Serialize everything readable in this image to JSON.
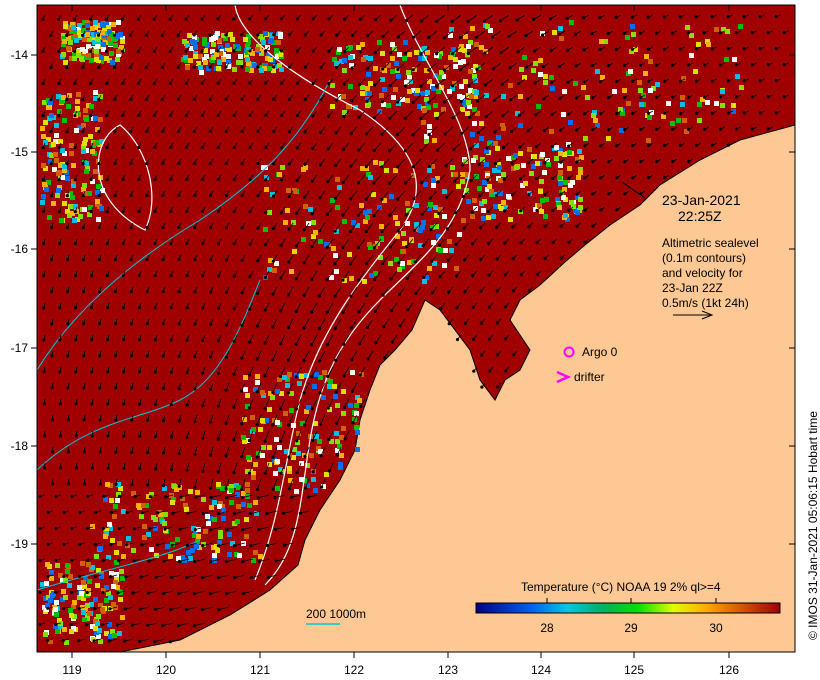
{
  "map": {
    "date": "23-Jan-2021",
    "time": "22:25Z",
    "description_lines": [
      "Altimetric sealevel",
      "(0.1m contours)",
      "and velocity for",
      "23-Jan 22Z",
      "0.5m/s (1kt 24h)"
    ],
    "argo_label": "Argo 0",
    "drifter_label": "drifter",
    "scale_label": "200  1000m",
    "colorbar_title": "Temperature (°C) NOAA 19 2% ql>=4",
    "colorbar_ticks": [
      "28",
      "29",
      "30"
    ],
    "lon_ticks": [
      "119",
      "120",
      "121",
      "122",
      "123",
      "124",
      "125",
      "126"
    ],
    "lat_ticks": [
      "-14",
      "-15",
      "-16",
      "-17",
      "-18",
      "-19"
    ],
    "credit": "© IMOS 31-Jan-2021 05:06:15 Hobart time",
    "colors": {
      "land": "#fdc894",
      "warm_sst": "#a00000",
      "argo": "#ff00ff",
      "isobath": "#00c8d8"
    }
  }
}
